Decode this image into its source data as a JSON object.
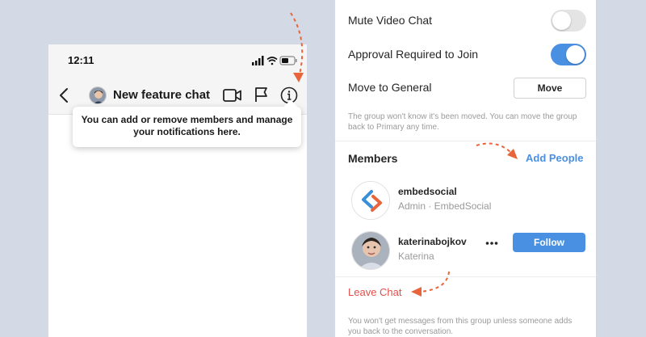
{
  "colors": {
    "background": "#d3d9e5",
    "accent_blue": "#4a90e2",
    "leave_red": "#e0504b",
    "annotation_arrow": "#e8643a"
  },
  "left_phone": {
    "status_bar": {
      "time": "12:11",
      "icons": [
        "signal-bars-icon",
        "wifi-icon",
        "battery-icon"
      ]
    },
    "header": {
      "back_icon": "chevron-left-icon",
      "title": "New feature chat",
      "actions": [
        "video-camera-icon",
        "flag-icon",
        "info-icon"
      ]
    },
    "tooltip": {
      "text": "You can add or remove members and manage your notifications here."
    }
  },
  "right_panel": {
    "settings": {
      "mute_video_chat": {
        "label": "Mute Video Chat",
        "enabled": false
      },
      "approval_required": {
        "label": "Approval Required to Join",
        "enabled": true
      },
      "move_to_general": {
        "label": "Move to General",
        "button_label": "Move",
        "helper": "The group won't know it's been moved. You can move the group back to Primary any time."
      }
    },
    "members_section": {
      "title": "Members",
      "add_label": "Add People",
      "members": [
        {
          "username": "embedsocial",
          "subtitle": "Admin · EmbedSocial"
        },
        {
          "username": "katerinabojkov",
          "subtitle": "Katerina",
          "action_label": "Follow"
        }
      ]
    },
    "leave": {
      "label": "Leave Chat",
      "helper": "You won't get messages from this group unless someone adds you back to the conversation."
    }
  }
}
